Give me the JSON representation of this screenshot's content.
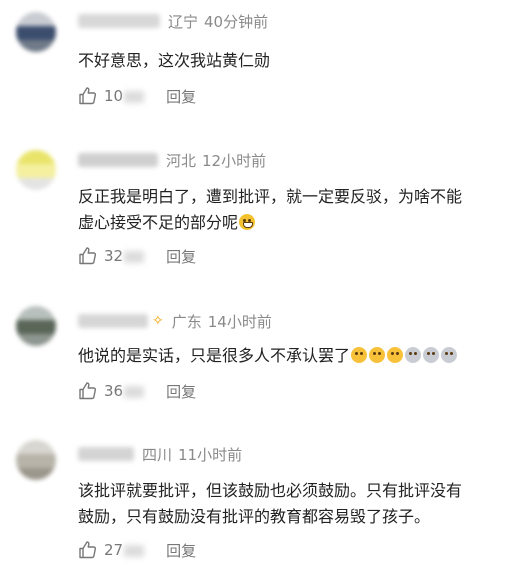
{
  "comments": [
    {
      "location": "辽宁",
      "time": "40分钟前",
      "text": "不好意思，这次我站黄仁勋",
      "likes": "10",
      "reply_label": "回复"
    },
    {
      "location": "河北",
      "time": "12小时前",
      "text_line1": "反正我是明白了，遭到批评，就一定要反驳，为啥不能",
      "text_line2": "虚心接受不足的部分呢",
      "likes": "32",
      "reply_label": "回复"
    },
    {
      "location": "广东",
      "time": "14小时前",
      "text": "他说的是实话，只是很多人不承认罢了",
      "likes": "36",
      "reply_label": "回复"
    },
    {
      "location": "四川",
      "time": "11小时前",
      "text_line1": "该批评就要批评，但该鼓励也必须鼓励。只有批评没有",
      "text_line2": "鼓励，只有鼓励没有批评的教育都容易毁了孩子。",
      "likes": "27",
      "reply_label": "回复"
    }
  ],
  "colors": {
    "meta_gray": "#8a8a8a",
    "text": "#222222",
    "vip_gold": "#f0a400"
  },
  "icons": [
    "thumbs-up-icon",
    "grin-emoji",
    "thinking-emoji",
    "doge-emoji",
    "vip-badge-icon"
  ]
}
